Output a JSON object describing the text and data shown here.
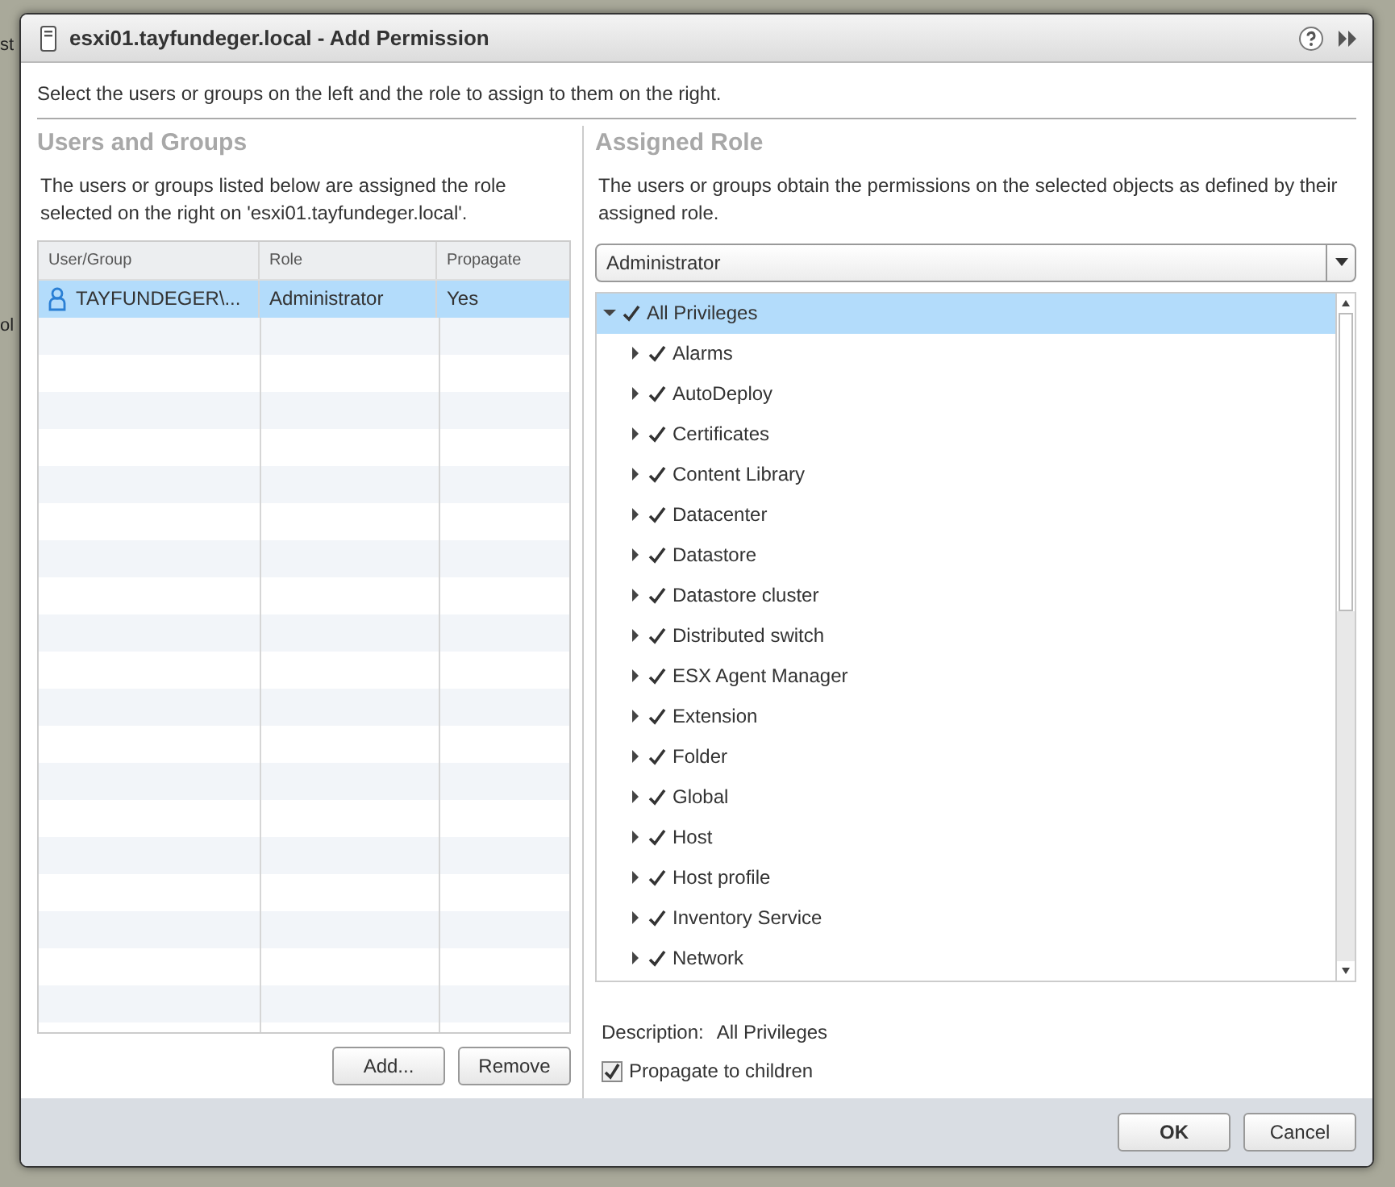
{
  "background": {
    "fragments": [
      "st",
      "ol"
    ]
  },
  "window": {
    "title": "esxi01.tayfundeger.local - Add Permission"
  },
  "intro": "Select the users or groups on the left and the role to assign to them on the right.",
  "users_panel": {
    "heading": "Users and Groups",
    "description": "The users or groups listed below are assigned the role selected on the right on 'esxi01.tayfundeger.local'.",
    "table": {
      "columns": [
        "User/Group",
        "Role",
        "Propagate"
      ],
      "rows": [
        {
          "cells": [
            "TAYFUNDEGER\\...",
            "Administrator",
            "Yes"
          ],
          "selected": true
        }
      ]
    },
    "buttons": [
      "Add...",
      "Remove"
    ]
  },
  "role_panel": {
    "heading": "Assigned Role",
    "description": "The users or groups obtain the permissions on the selected objects as defined by their assigned role.",
    "role_select": {
      "value": "Administrator"
    },
    "privileges": [
      {
        "label": "All Privileges",
        "checked": true,
        "expanded": true,
        "selected": true,
        "children": [
          {
            "label": "Alarms",
            "checked": true,
            "expanded": false,
            "selected": false
          },
          {
            "label": "AutoDeploy",
            "checked": true,
            "expanded": false,
            "selected": false
          },
          {
            "label": "Certificates",
            "checked": true,
            "expanded": false,
            "selected": false
          },
          {
            "label": "Content Library",
            "checked": true,
            "expanded": false,
            "selected": false
          },
          {
            "label": "Datacenter",
            "checked": true,
            "expanded": false,
            "selected": false
          },
          {
            "label": "Datastore",
            "checked": true,
            "expanded": false,
            "selected": false
          },
          {
            "label": "Datastore cluster",
            "checked": true,
            "expanded": false,
            "selected": false
          },
          {
            "label": "Distributed switch",
            "checked": true,
            "expanded": false,
            "selected": false
          },
          {
            "label": "ESX Agent Manager",
            "checked": true,
            "expanded": false,
            "selected": false
          },
          {
            "label": "Extension",
            "checked": true,
            "expanded": false,
            "selected": false
          },
          {
            "label": "Folder",
            "checked": true,
            "expanded": false,
            "selected": false
          },
          {
            "label": "Global",
            "checked": true,
            "expanded": false,
            "selected": false
          },
          {
            "label": "Host",
            "checked": true,
            "expanded": false,
            "selected": false
          },
          {
            "label": "Host profile",
            "checked": true,
            "expanded": false,
            "selected": false
          },
          {
            "label": "Inventory Service",
            "checked": true,
            "expanded": false,
            "selected": false
          },
          {
            "label": "Network",
            "checked": true,
            "expanded": false,
            "selected": false
          }
        ]
      }
    ],
    "description_label": "Description:",
    "description_value": "All Privileges",
    "propagate": {
      "label": "Propagate to children",
      "checked": true
    }
  },
  "footer_buttons": [
    "OK",
    "Cancel"
  ]
}
